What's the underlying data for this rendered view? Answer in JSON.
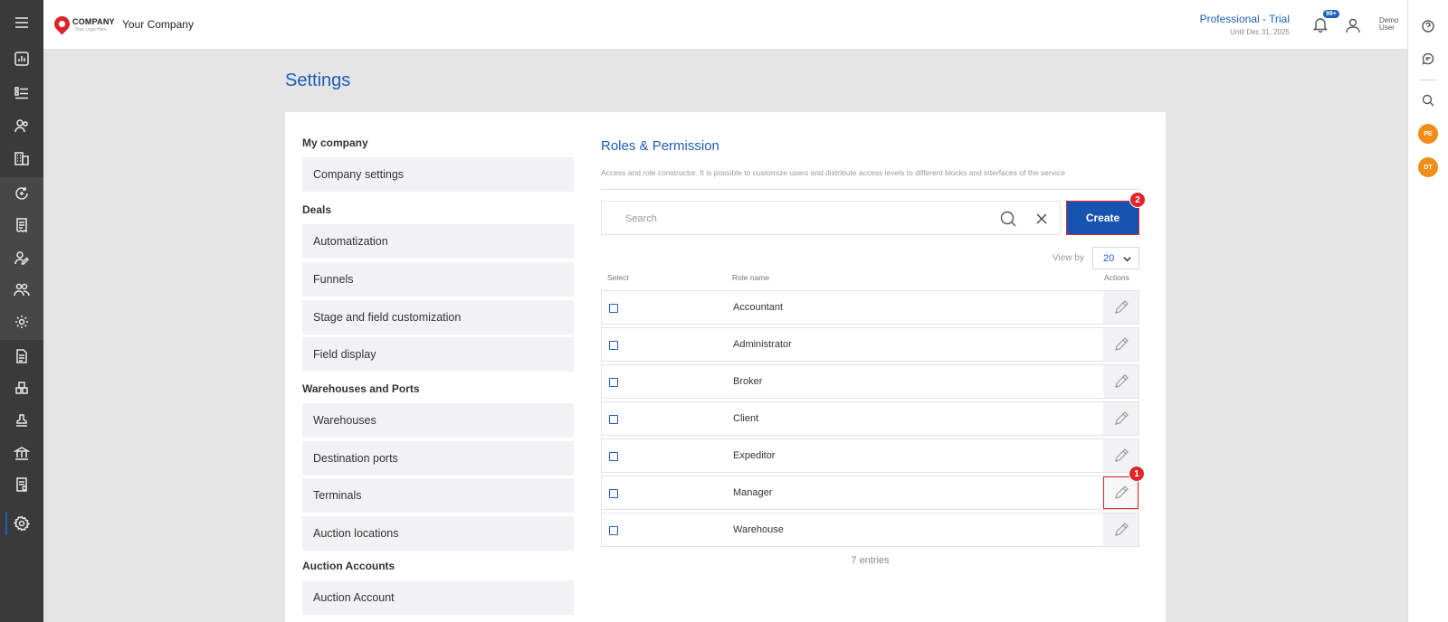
{
  "header": {
    "logo_title": "COMPANY",
    "logo_subtitle": "Your Logo Here",
    "company_name": "Your Company",
    "plan_name": "Professional - Trial",
    "plan_until": "Until Dec 31, 2025",
    "notifications_badge": "99+",
    "user_name": "Demo User"
  },
  "left_sidebar": {
    "icons": [
      "menu-icon",
      "dashboard-icon",
      "list-icon",
      "contacts-icon",
      "buildings-icon",
      "sync-icon",
      "receipt-icon",
      "user-edit-icon",
      "users-icon",
      "gear-user-icon",
      "document-icon",
      "warehouse-icon",
      "stamp-icon",
      "bank-icon",
      "invoice-icon",
      "settings-icon"
    ]
  },
  "right_rail": {
    "avatars": [
      "PE",
      "DT"
    ]
  },
  "page": {
    "title": "Settings"
  },
  "settings_menu": {
    "sections": [
      {
        "title": "My company",
        "items": [
          "Company settings"
        ]
      },
      {
        "title": "Deals",
        "items": [
          "Automatization",
          "Funnels",
          "Stage and field customization",
          "Field display"
        ]
      },
      {
        "title": "Warehouses and Ports",
        "items": [
          "Warehouses",
          "Destination ports",
          "Terminals",
          "Auction locations"
        ]
      },
      {
        "title": "Auction Accounts",
        "items": [
          "Auction Account"
        ]
      }
    ]
  },
  "roles": {
    "title": "Roles & Permission",
    "description": "Access and role constructor. It is possible to customize users and distribute access levels to different blocks and interfaces of the service",
    "search_placeholder": "Search",
    "create_label": "Create",
    "view_by_label": "View by",
    "view_by_value": "20",
    "columns": {
      "select": "Select",
      "role_name": "Role name",
      "actions": "Actions"
    },
    "rows": [
      "Accountant",
      "Administrator",
      "Broker",
      "Client",
      "Expeditor",
      "Manager",
      "Warehouse"
    ],
    "entries_text": "7 entries"
  },
  "annotations": {
    "step_1": "1",
    "step_2": "2"
  },
  "colors": {
    "accent": "#1d5db8",
    "sidebar": "#3a3a3a",
    "highlight": "#e0262c",
    "avatar": "#f08c1a"
  }
}
